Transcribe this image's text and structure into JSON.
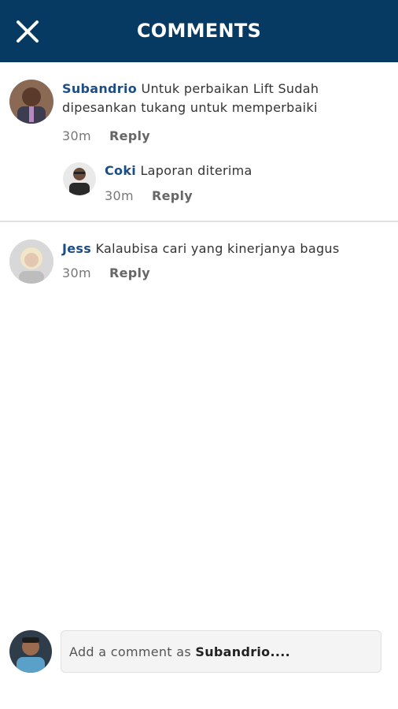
{
  "header": {
    "title": "COMMENTS",
    "close_icon": "close-icon"
  },
  "comments": [
    {
      "author": "Subandrio",
      "text": "Untuk perbaikan Lift Sudah dipesankan tukang untuk memperbaiki",
      "time": "30m",
      "reply_label": "Reply",
      "replies": [
        {
          "author": "Coki",
          "text": "Laporan diterima",
          "time": "30m",
          "reply_label": "Reply"
        }
      ]
    },
    {
      "author": "Jess",
      "text": "Kalaubisa cari yang kinerjanya bagus",
      "time": "30m",
      "reply_label": "Reply"
    }
  ],
  "composer": {
    "prefix": "Add a comment as ",
    "user": "Subandrio...."
  },
  "colors": {
    "header_bg": "#073a63",
    "author": "#1c4d86"
  }
}
